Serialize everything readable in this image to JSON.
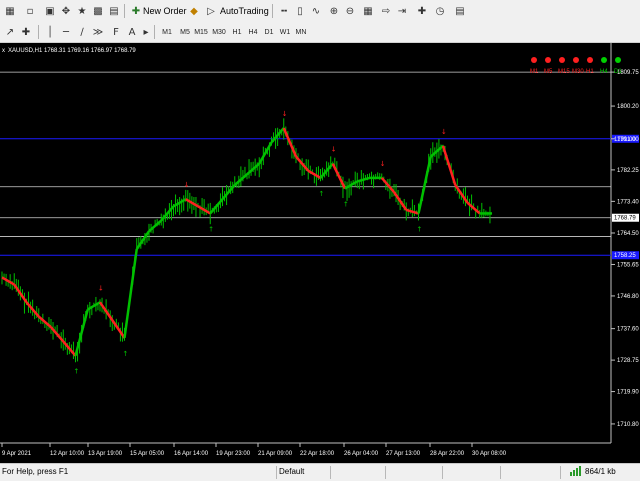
{
  "toolbar": {
    "new_order_label": "New Order",
    "autotrading_label": "AutoTrading",
    "timeframes": [
      "M1",
      "M5",
      "M15",
      "M30",
      "H1",
      "H4",
      "D1",
      "W1",
      "MN"
    ]
  },
  "chart": {
    "symbol_info": "XAUUSD,H1  1768.31 1769.16 1766.97 1768.79",
    "close_label": "x",
    "indicator_labels": [
      "M1",
      "M5",
      "M15",
      "M30",
      "H1",
      "H4",
      "D1"
    ],
    "indicator_colors": [
      "red",
      "red",
      "red",
      "red",
      "red",
      "green",
      "green"
    ],
    "price_ticks": [
      "1809.75",
      "1800.20",
      "1791.00",
      "1782.25",
      "1773.40",
      "1764.50",
      "1755.65",
      "1746.80",
      "1737.60",
      "1728.75",
      "1719.90",
      "1710.80"
    ],
    "time_ticks": [
      "9 Apr 2021",
      "12 Apr 10:00",
      "13 Apr 19:00",
      "15 Apr 05:00",
      "16 Apr 14:00",
      "19 Apr 23:00",
      "21 Apr 09:00",
      "22 Apr 18:00",
      "26 Apr 04:00",
      "27 Apr 13:00",
      "28 Apr 22:00",
      "30 Apr 08:00"
    ],
    "current_price": "1768.79",
    "blue_line_labels": [
      "1791.00",
      "1758.25"
    ],
    "colors": {
      "bull": "#00c000",
      "bear": "#ff2020",
      "grid": "#c0c0c0",
      "blue_line": "#1a1aff",
      "background": "#000000"
    }
  },
  "chart_data": {
    "type": "line",
    "title": "XAUUSD,H1",
    "series": [
      {
        "name": "",
        "values": [
          1752,
          1750,
          1745,
          1741,
          1738,
          1734,
          1730,
          1743,
          1745,
          1740,
          1735,
          1760,
          1765,
          1768,
          1772,
          1774,
          1772,
          1770,
          1774,
          1778,
          1781,
          1784,
          1790,
          1794,
          1786,
          1782,
          1780,
          1784,
          1777,
          1779,
          1780,
          1780,
          1776,
          1771,
          1770,
          1786,
          1789,
          1778,
          1773,
          1770,
          1770
        ]
      }
    ],
    "ylim": [
      1706,
      1814
    ],
    "ytick_labels": [
      "1809.75",
      "1800.20",
      "1791.00",
      "1782.25",
      "1773.40",
      "1764.50",
      "1755.65",
      "1746.80",
      "1737.60",
      "1728.75",
      "1719.90",
      "1710.80"
    ]
  },
  "status": {
    "help_text": "For Help, press F1",
    "profile": "Default",
    "traffic": "864/1 kb"
  }
}
